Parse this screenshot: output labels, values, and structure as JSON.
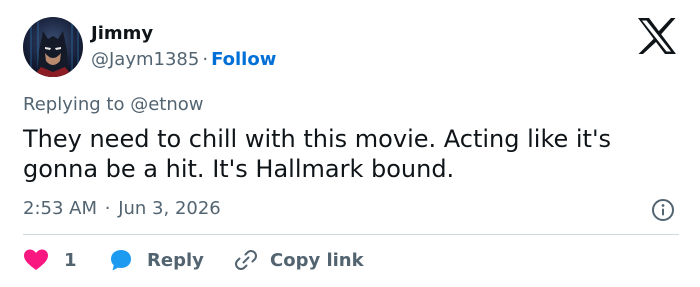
{
  "user": {
    "display_name": "Jimmy",
    "handle": "@Jaym1385",
    "separator": "·",
    "follow_label": "Follow"
  },
  "tweet": {
    "replying_to": "Replying to @etnow",
    "text": "They need to chill with this movie. Acting like it's gonna be a hit. It's Hallmark bound.",
    "time": "2:53 AM",
    "date_separator": "·",
    "date": "Jun 3, 2026"
  },
  "actions": {
    "like_count": "1",
    "reply_label": "Reply",
    "copy_link_label": "Copy link"
  },
  "icons": {
    "brand": "x-logo-icon",
    "info": "info-icon",
    "like": "heart-icon",
    "reply": "speech-bubble-icon",
    "copy_link": "link-icon"
  },
  "colors": {
    "follow": "#006fd6",
    "like": "#f91880",
    "reply": "#1d9bf0",
    "secondary_text": "#536471",
    "divider": "#cfd9de"
  }
}
